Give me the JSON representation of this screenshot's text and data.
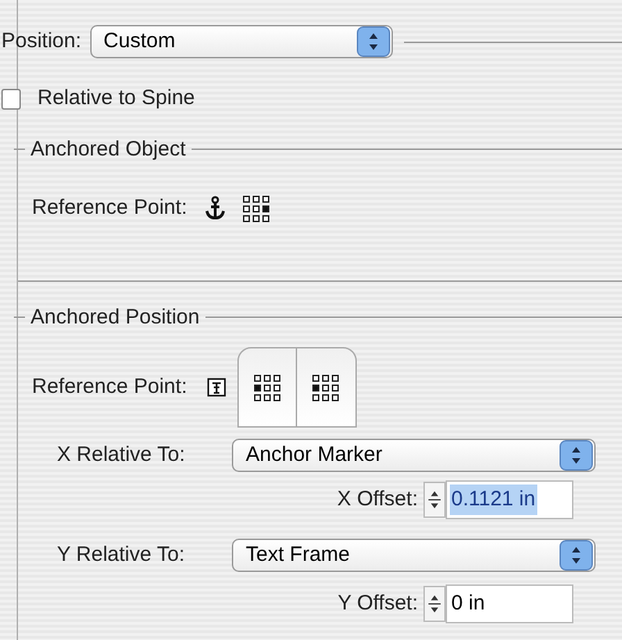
{
  "position": {
    "label": "Position:",
    "value": "Custom"
  },
  "relative_to_spine": {
    "label": "Relative to Spine",
    "checked": false
  },
  "anchored_object": {
    "title": "Anchored Object",
    "reference_point": {
      "label": "Reference Point:",
      "points": [
        {
          "selected": false
        },
        {
          "selected": false
        },
        {
          "selected": false
        },
        {
          "selected": false
        },
        {
          "selected": false
        },
        {
          "selected": true
        },
        {
          "selected": false
        },
        {
          "selected": false
        },
        {
          "selected": false
        }
      ]
    }
  },
  "anchored_position": {
    "title": "Anchored Position",
    "reference_point": {
      "label": "Reference Point:",
      "pages": [
        {
          "points": [
            {
              "selected": false
            },
            {
              "selected": false
            },
            {
              "selected": false
            },
            {
              "selected": true
            },
            {
              "selected": false
            },
            {
              "selected": false
            },
            {
              "selected": false
            },
            {
              "selected": false
            },
            {
              "selected": false
            }
          ]
        },
        {
          "points": [
            {
              "selected": false
            },
            {
              "selected": false
            },
            {
              "selected": false
            },
            {
              "selected": true
            },
            {
              "selected": false
            },
            {
              "selected": false
            },
            {
              "selected": false
            },
            {
              "selected": false
            },
            {
              "selected": false
            }
          ]
        }
      ]
    },
    "x_relative_to": {
      "label": "X Relative To:",
      "value": "Anchor Marker"
    },
    "x_offset": {
      "label": "X Offset:",
      "value": "0.1121 in",
      "selected": true
    },
    "y_relative_to": {
      "label": "Y Relative To:",
      "value": "Text Frame"
    },
    "y_offset": {
      "label": "Y Offset:",
      "value": "0 in",
      "selected": false
    }
  }
}
